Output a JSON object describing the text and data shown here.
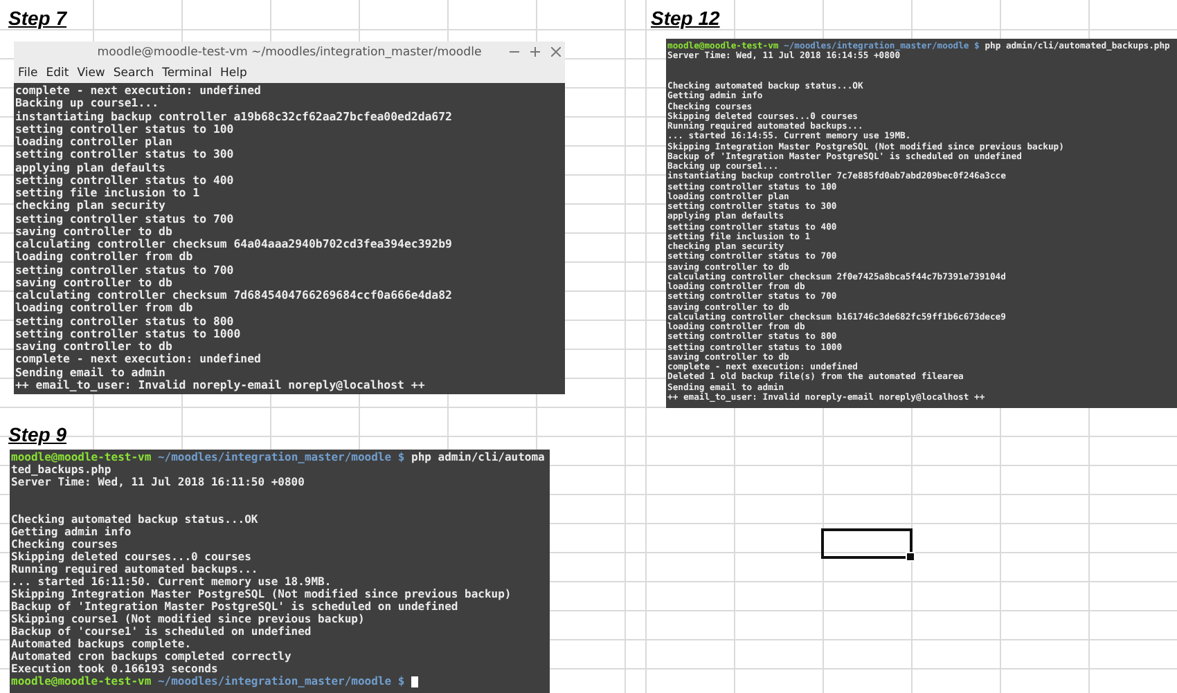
{
  "snapshots": [
    {
      "heading": "Step 7",
      "kind": "window",
      "title": "moodle@moodle-test-vm ~/moodles/integration_master/moodle",
      "menu": [
        "File",
        "Edit",
        "View",
        "Search",
        "Terminal",
        "Help"
      ],
      "lines": [
        {
          "kind": "text",
          "text": "complete - next execution: undefined"
        },
        {
          "kind": "text",
          "text": "Backing up course1..."
        },
        {
          "kind": "text",
          "text": "instantiating backup controller a19b68c32cf62aa27bcfea00ed2da672"
        },
        {
          "kind": "text",
          "text": "setting controller status to 100"
        },
        {
          "kind": "text",
          "text": "loading controller plan"
        },
        {
          "kind": "text",
          "text": "setting controller status to 300"
        },
        {
          "kind": "text",
          "text": "applying plan defaults"
        },
        {
          "kind": "text",
          "text": "setting controller status to 400"
        },
        {
          "kind": "text",
          "text": "setting file inclusion to 1"
        },
        {
          "kind": "text",
          "text": "checking plan security"
        },
        {
          "kind": "text",
          "text": "setting controller status to 700"
        },
        {
          "kind": "text",
          "text": "saving controller to db"
        },
        {
          "kind": "text",
          "text": "calculating controller checksum 64a04aaa2940b702cd3fea394ec392b9"
        },
        {
          "kind": "text",
          "text": "loading controller from db"
        },
        {
          "kind": "text",
          "text": "setting controller status to 700"
        },
        {
          "kind": "text",
          "text": "saving controller to db"
        },
        {
          "kind": "text",
          "text": "calculating controller checksum 7d6845404766269684ccf0a666e4da82"
        },
        {
          "kind": "text",
          "text": "loading controller from db"
        },
        {
          "kind": "text",
          "text": "setting controller status to 800"
        },
        {
          "kind": "text",
          "text": "setting controller status to 1000"
        },
        {
          "kind": "text",
          "text": "saving controller to db"
        },
        {
          "kind": "text",
          "text": "complete - next execution: undefined"
        },
        {
          "kind": "text",
          "text": "Sending email to admin"
        },
        {
          "kind": "text",
          "text": "++ email_to_user: Invalid noreply-email noreply@localhost ++"
        }
      ]
    },
    {
      "heading": "Step 12",
      "kind": "output",
      "lines": [
        {
          "kind": "prompt",
          "user": "moodle@moodle-test-vm",
          "path": "~/moodles/integration_master/moodle $",
          "command": "php admin/cli/automated_backups.php"
        },
        {
          "kind": "text",
          "text": "Server Time: Wed, 11 Jul 2018 16:14:55 +0800"
        },
        {
          "kind": "blank"
        },
        {
          "kind": "blank"
        },
        {
          "kind": "text",
          "text": "Checking automated backup status...OK"
        },
        {
          "kind": "text",
          "text": "Getting admin info"
        },
        {
          "kind": "text",
          "text": "Checking courses"
        },
        {
          "kind": "text",
          "text": "Skipping deleted courses...0 courses"
        },
        {
          "kind": "text",
          "text": "Running required automated backups..."
        },
        {
          "kind": "text",
          "text": "... started 16:14:55. Current memory use 19MB."
        },
        {
          "kind": "text",
          "text": "Skipping Integration Master PostgreSQL (Not modified since previous backup)"
        },
        {
          "kind": "text",
          "text": "Backup of 'Integration Master PostgreSQL' is scheduled on undefined"
        },
        {
          "kind": "text",
          "text": "Backing up course1..."
        },
        {
          "kind": "text",
          "text": "instantiating backup controller 7c7e885fd0ab7abd209bec0f246a3cce"
        },
        {
          "kind": "text",
          "text": "setting controller status to 100"
        },
        {
          "kind": "text",
          "text": "loading controller plan"
        },
        {
          "kind": "text",
          "text": "setting controller status to 300"
        },
        {
          "kind": "text",
          "text": "applying plan defaults"
        },
        {
          "kind": "text",
          "text": "setting controller status to 400"
        },
        {
          "kind": "text",
          "text": "setting file inclusion to 1"
        },
        {
          "kind": "text",
          "text": "checking plan security"
        },
        {
          "kind": "text",
          "text": "setting controller status to 700"
        },
        {
          "kind": "text",
          "text": "saving controller to db"
        },
        {
          "kind": "text",
          "text": "calculating controller checksum 2f0e7425a8bca5f44c7b7391e739104d"
        },
        {
          "kind": "text",
          "text": "loading controller from db"
        },
        {
          "kind": "text",
          "text": "setting controller status to 700"
        },
        {
          "kind": "text",
          "text": "saving controller to db"
        },
        {
          "kind": "text",
          "text": "calculating controller checksum b161746c3de682fc59ff1b6c673dece9"
        },
        {
          "kind": "text",
          "text": "loading controller from db"
        },
        {
          "kind": "text",
          "text": "setting controller status to 800"
        },
        {
          "kind": "text",
          "text": "setting controller status to 1000"
        },
        {
          "kind": "text",
          "text": "saving controller to db"
        },
        {
          "kind": "text",
          "text": "complete - next execution: undefined"
        },
        {
          "kind": "text",
          "text": "Deleted 1 old backup file(s) from the automated filearea"
        },
        {
          "kind": "text",
          "text": "Sending email to admin"
        },
        {
          "kind": "text",
          "text": "++ email_to_user: Invalid noreply-email noreply@localhost ++"
        }
      ]
    },
    {
      "heading": "Step 9",
      "kind": "output",
      "lines": [
        {
          "kind": "prompt",
          "user": "moodle@moodle-test-vm",
          "path": "~/moodles/integration_master/moodle $",
          "command": "php admin/cli/automa"
        },
        {
          "kind": "text",
          "text": "ted_backups.php"
        },
        {
          "kind": "text",
          "text": "Server Time: Wed, 11 Jul 2018 16:11:50 +0800"
        },
        {
          "kind": "blank"
        },
        {
          "kind": "blank"
        },
        {
          "kind": "text",
          "text": "Checking automated backup status...OK"
        },
        {
          "kind": "text",
          "text": "Getting admin info"
        },
        {
          "kind": "text",
          "text": "Checking courses"
        },
        {
          "kind": "text",
          "text": "Skipping deleted courses...0 courses"
        },
        {
          "kind": "text",
          "text": "Running required automated backups..."
        },
        {
          "kind": "text",
          "text": "... started 16:11:50. Current memory use 18.9MB."
        },
        {
          "kind": "text",
          "text": "Skipping Integration Master PostgreSQL (Not modified since previous backup)"
        },
        {
          "kind": "text",
          "text": "Backup of 'Integration Master PostgreSQL' is scheduled on undefined"
        },
        {
          "kind": "text",
          "text": "Skipping course1 (Not modified since previous backup)"
        },
        {
          "kind": "text",
          "text": "Backup of 'course1' is scheduled on undefined"
        },
        {
          "kind": "text",
          "text": "Automated backups complete."
        },
        {
          "kind": "text",
          "text": "Automated cron backups completed correctly"
        },
        {
          "kind": "text",
          "text": "Execution took 0.166193 seconds"
        },
        {
          "kind": "prompt",
          "user": "moodle@moodle-test-vm",
          "path": "~/moodles/integration_master/moodle $",
          "cursor": true
        }
      ]
    }
  ]
}
